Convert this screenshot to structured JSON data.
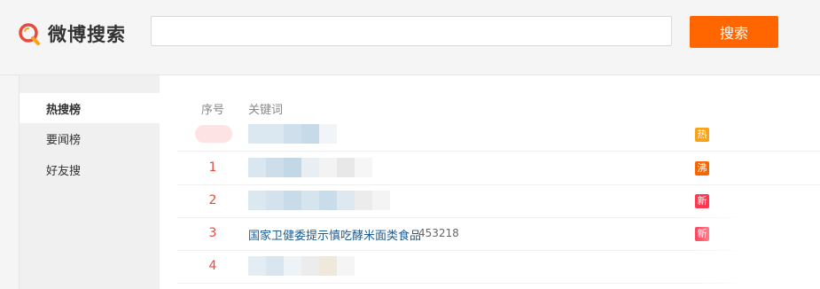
{
  "header": {
    "logo_text": "微博搜索",
    "search": {
      "value": "",
      "placeholder": ""
    },
    "search_button_label": "搜索"
  },
  "sidebar": {
    "items": [
      {
        "label": "热搜榜",
        "active": true
      },
      {
        "label": "要闻榜",
        "active": false
      },
      {
        "label": "好友搜",
        "active": false
      }
    ]
  },
  "table": {
    "columns": [
      "序号",
      "关键词"
    ],
    "rows": [
      {
        "rank": "",
        "keyword": "",
        "count": "",
        "badge": "热",
        "badge_color": "#f7a21b"
      },
      {
        "rank": "1",
        "keyword": "",
        "count": "",
        "badge": "沸",
        "badge_color": "#f86400"
      },
      {
        "rank": "2",
        "keyword": "",
        "count": "",
        "badge": "新",
        "badge_color": "#ff3852"
      },
      {
        "rank": "3",
        "keyword": "国家卫健委提示慎吃酵米面类食品",
        "count": "453218",
        "badge": "新",
        "badge_color": "#ff3852"
      },
      {
        "rank": "4",
        "keyword": "",
        "count": "",
        "badge": "",
        "badge_color": ""
      }
    ]
  },
  "colors": {
    "accent": "#ff6600",
    "link": "#1e5c91",
    "rank": "#e64b3c"
  }
}
